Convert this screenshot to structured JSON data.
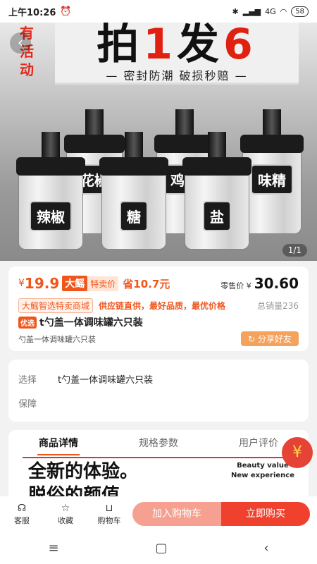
{
  "status_bar": {
    "time": "上午10:26",
    "battery": "58",
    "network": "4G"
  },
  "hero": {
    "activity_tag": "有活动",
    "headline_a": "拍",
    "headline_num1": "1",
    "headline_b": "发",
    "headline_num2": "6",
    "subline": "— 密封防潮 破损秒赔 —",
    "jar_labels": [
      "辣椒",
      "糖",
      "盐",
      "味精",
      "花椒",
      "鸡精"
    ],
    "image_counter": "1/1"
  },
  "price": {
    "currency": "¥",
    "amount": "19.9",
    "brand_badge": "大鳐",
    "special": "特卖价",
    "save": "省10.7元",
    "retail_label": "零售价 ¥",
    "retail_price": "30.60",
    "shop_tag": "大鳐智选特卖商城",
    "slogan": "供应链直供，最好品质，最优价格",
    "sold": "总销量236",
    "pref_tag": "优选",
    "title": "t勺盖一体调味罐六只装",
    "subtitle": "勺盖一体调味罐六只装",
    "share": "分享好友"
  },
  "options": {
    "select_label": "选择",
    "select_value": "t勺盖一体调味罐六只装",
    "guarantee_label": "保障"
  },
  "detail": {
    "tabs": [
      "商品详情",
      "规格参数",
      "用户评价"
    ],
    "big_line1": "全新的体验。",
    "big_line2": "脱俗的颜值",
    "en_line1": "Beauty value",
    "en_line2": "New experience"
  },
  "bottom_bar": {
    "service": "客服",
    "favorite": "收藏",
    "cart": "购物车",
    "add_cart": "加入购物车",
    "buy_now": "立即购买"
  },
  "colors": {
    "accent": "#f0561c",
    "buy": "#f0402e",
    "cart": "#f5a090"
  }
}
